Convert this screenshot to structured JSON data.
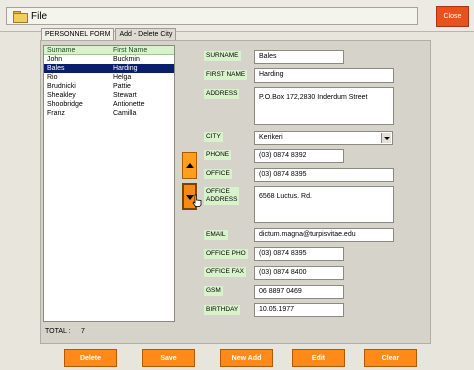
{
  "menu": {
    "file_label": "File",
    "close_label": "Close"
  },
  "tabs": [
    {
      "label": "PERSONNEL FORM"
    },
    {
      "label": "Add - Delete City"
    }
  ],
  "list": {
    "headers": [
      "Surname",
      "First Name"
    ],
    "rows": [
      {
        "surname": "John",
        "first_name": "Buckmin"
      },
      {
        "surname": "Bales",
        "first_name": "Harding"
      },
      {
        "surname": "Rio",
        "first_name": "Helga"
      },
      {
        "surname": "Brudnicki",
        "first_name": "Pattie"
      },
      {
        "surname": "Sheakley",
        "first_name": "Stewart"
      },
      {
        "surname": "Shoobridge",
        "first_name": "Antionette"
      },
      {
        "surname": "Franz",
        "first_name": "Camilla"
      }
    ],
    "selected_index": 1
  },
  "total": {
    "label": "TOTAL :",
    "value": "7"
  },
  "form": {
    "surname": {
      "label": "SURNAME",
      "value": "Bales"
    },
    "first_name": {
      "label": "FIRST NAME",
      "value": "Harding"
    },
    "address": {
      "label": "ADDRESS",
      "value": "P.O.Box 172,2830 Inderdum Street"
    },
    "city": {
      "label": "CITY",
      "value": "Kerikeri"
    },
    "phone": {
      "label": "PHONE",
      "value": "(03) 0874 8392"
    },
    "office": {
      "label": "OFFICE",
      "value": "(03) 0874 8395"
    },
    "office_address": {
      "label_line1": "OFFICE",
      "label_line2": "ADDRESS",
      "value": "6568 Luctus. Rd."
    },
    "email": {
      "label": "EMAIL",
      "value": "dictum.magna@turpisvitae.edu"
    },
    "office_pho": {
      "label": "OFFICE PHO",
      "value": "(03) 0874 8395"
    },
    "office_fax": {
      "label": "OFFICE FAX",
      "value": "(03) 0874 8400"
    },
    "gsm": {
      "label": "GSM",
      "value": "06 8897 0469"
    },
    "birthday": {
      "label": "BIRTHDAY",
      "value": "10.05.1977"
    }
  },
  "buttons": {
    "delete": "Delete",
    "save": "Save",
    "new_add": "New Add",
    "edit": "Edit",
    "clear": "Clear"
  },
  "colors": {
    "accent_orange": "#ff8a1a",
    "close_red": "#e8531c",
    "label_green": "#d8f3cc",
    "selection_navy": "#0a1f6b"
  }
}
